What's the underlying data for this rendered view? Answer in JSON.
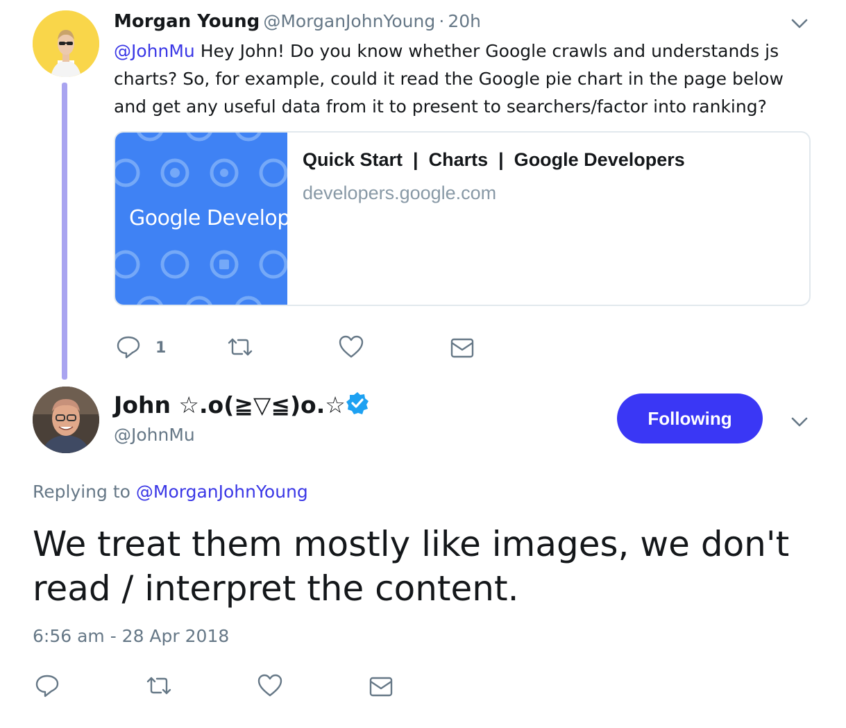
{
  "parent_tweet": {
    "name": "Morgan Young",
    "handle": "@MorganJohnYoung",
    "time_sep": "·",
    "time": "20h",
    "mention": "@JohnMu",
    "text": " Hey John! Do you know whether Google crawls and understands js charts? So, for example, could it read the Google pie chart in the page below and get any useful data from it to present to searchers/factor into ranking?",
    "card": {
      "image_text": "Google Develop",
      "title": "Quick Start  |  Charts  |  Google Developers",
      "domain": "developers.google.com"
    },
    "actions": {
      "reply_icon": "reply-icon",
      "reply_count": "1",
      "retweet_icon": "retweet-icon",
      "like_icon": "heart-icon",
      "dm_icon": "envelope-icon"
    }
  },
  "reply_tweet": {
    "name": "John ☆.o(≧▽≦)o.☆",
    "verified_icon": "verified-badge-icon",
    "handle": "@JohnMu",
    "follow_label": "Following",
    "replying_prefix": "Replying to ",
    "replying_to": "@MorganJohnYoung",
    "text": "We treat them mostly like images, we don't read / interpret the content.",
    "timestamp": "6:56 am - 28 Apr 2018",
    "actions": {
      "reply_icon": "reply-icon",
      "retweet_icon": "retweet-icon",
      "like_icon": "heart-icon",
      "dm_icon": "envelope-icon"
    }
  },
  "colors": {
    "link": "#3a37e6",
    "follow_button": "#3a37f5",
    "thread_line": "#a9a4f0",
    "verified": "#1da1f2",
    "card_image": "#3f82f4"
  }
}
